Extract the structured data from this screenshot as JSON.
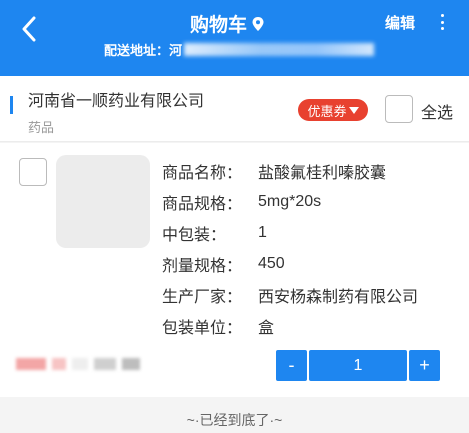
{
  "header": {
    "title": "购物车",
    "edit_label": "编辑",
    "address_label": "配送地址：",
    "address_value": "河"
  },
  "store": {
    "name": "河南省一顺药业有限公司",
    "category": "药品",
    "coupon_label": "优惠券",
    "select_all_label": "全选"
  },
  "item": {
    "fields": [
      {
        "key": "商品名称：",
        "value": "盐酸氟桂利嗪胶囊"
      },
      {
        "key": "商品规格：",
        "value": "5mg*20s"
      },
      {
        "key": "中包装：",
        "value": "1"
      },
      {
        "key": "剂量规格：",
        "value": "450"
      },
      {
        "key": "生产厂家：",
        "value": "西安杨森制药有限公司"
      },
      {
        "key": "包装单位：",
        "value": "盒"
      }
    ],
    "quantity": "1",
    "minus_label": "-",
    "plus_label": "+"
  },
  "footer_note": "~·已经到底了·~",
  "colors": {
    "brand": "#1e86f0",
    "coupon": "#e8412f"
  },
  "icons": [
    "back-arrow-icon",
    "location-pin-icon",
    "more-vertical-icon",
    "dropdown-triangle-icon"
  ]
}
